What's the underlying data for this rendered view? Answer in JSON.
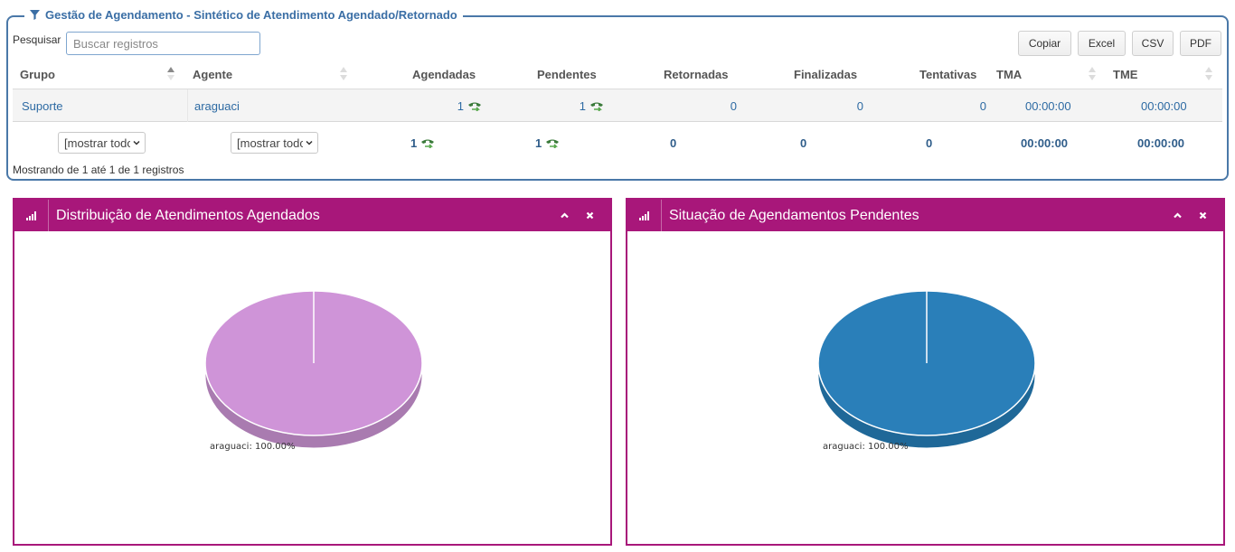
{
  "panel": {
    "title": "Gestão de Agendamento - Sintético de Atendimento Agendado/Retornado"
  },
  "search": {
    "label": "Pesquisar",
    "placeholder": "Buscar registros",
    "value": ""
  },
  "export_buttons": [
    "Copiar",
    "Excel",
    "CSV",
    "PDF"
  ],
  "table": {
    "columns": [
      "Grupo",
      "Agente",
      "Agendadas",
      "Pendentes",
      "Retornadas",
      "Finalizadas",
      "Tentativas",
      "TMA",
      "TME"
    ],
    "rows": [
      {
        "grupo": "Suporte",
        "agente": "araguaci",
        "agendadas": "1",
        "pendentes": "1",
        "retornadas": "0",
        "finalizadas": "0",
        "tentativas": "0",
        "tma": "00:00:00",
        "tme": "00:00:00"
      }
    ],
    "footer": {
      "grupo_filter": "[mostrar todos]",
      "agente_filter": "[mostrar todos]",
      "agendadas": "1",
      "pendentes": "1",
      "retornadas": "0",
      "finalizadas": "0",
      "tentativas": "0",
      "tma": "00:00:00",
      "tme": "00:00:00"
    },
    "info": "Mostrando de 1 até 1 de 1 registros"
  },
  "widgets": [
    {
      "title": "Distribuição de Atendimentos Agendados",
      "icon": "bar-chart-icon",
      "pie_label": "araguaci: 100.00%",
      "color_top": "#cf94d8",
      "color_side": "#a97bb0"
    },
    {
      "title": "Situação de Agendamentos Pendentes",
      "icon": "bar-chart-icon",
      "pie_label": "araguaci: 100.00%",
      "color_top": "#2a7fb9",
      "color_side": "#1f6898"
    }
  ],
  "chart_data": [
    {
      "type": "pie",
      "title": "Distribuição de Atendimentos Agendados",
      "labels": [
        "araguaci"
      ],
      "values": [
        100.0
      ]
    },
    {
      "type": "pie",
      "title": "Situação de Agendamentos Pendentes",
      "labels": [
        "araguaci"
      ],
      "values": [
        100.0
      ]
    }
  ],
  "colors": {
    "panel_border": "#4a78a8",
    "link": "#2d6aa3",
    "widget_header": "#a8177a"
  }
}
